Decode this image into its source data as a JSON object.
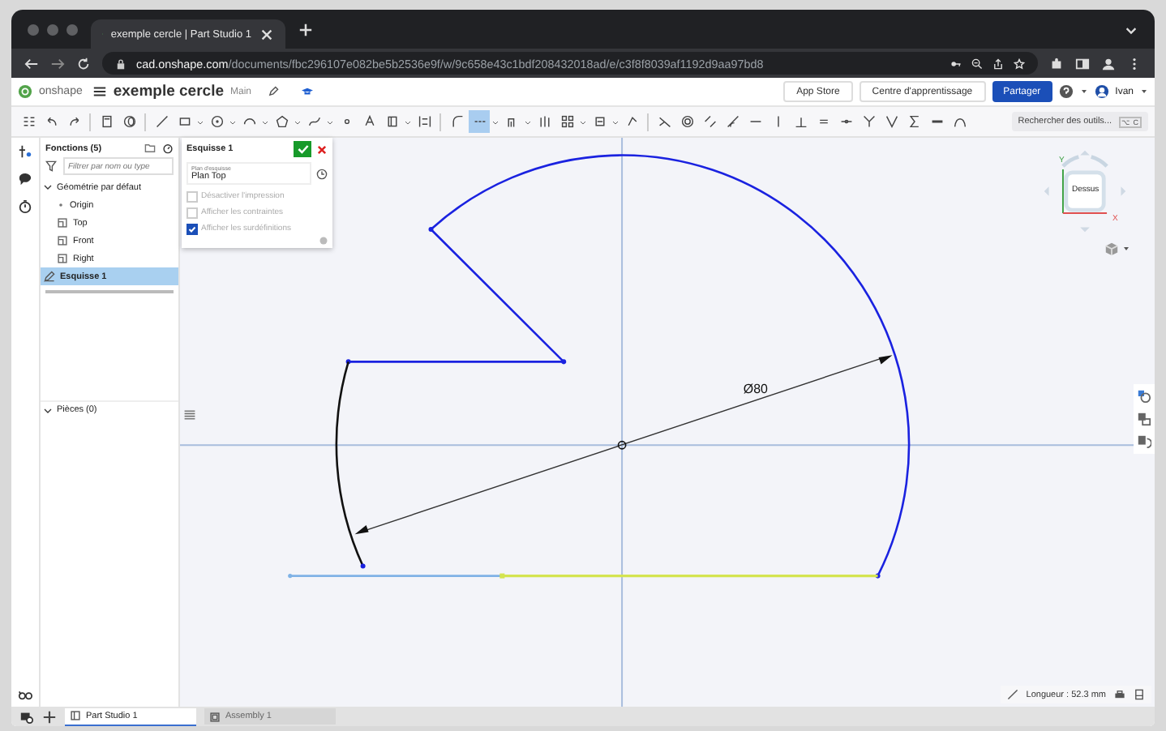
{
  "browser": {
    "tab_title": "exemple cercle | Part Studio 1",
    "url": {
      "host": "cad.onshape.com",
      "path": "/documents/fbc296107e082be5b2536e9f/w/9c658e43c1bdf208432018ad/e/c3f8f8039af1192d9aa97bd8"
    }
  },
  "header": {
    "logo": "onshape",
    "document": "exemple cercle",
    "branch": "Main",
    "buttons": [
      "App Store",
      "Centre d'apprentissage"
    ],
    "share": "Partager",
    "user": "Ivan"
  },
  "toolbar": {
    "tools": [
      {
        "selected": false
      },
      {
        "selected": false
      },
      {
        "selected": false
      },
      {
        "selected": false
      },
      {
        "selected": false
      },
      {
        "selected": false
      },
      {
        "selected": false
      },
      {
        "selected": false
      },
      {
        "selected": false
      },
      {
        "selected": false
      },
      {
        "selected": false
      },
      {
        "selected": false
      },
      {
        "selected": false
      },
      {
        "selected": false
      },
      {
        "selected": false
      },
      {
        "selected": false
      },
      {
        "selected": true
      },
      {
        "selected": false
      },
      {
        "selected": false
      },
      {
        "selected": false
      },
      {
        "selected": false
      },
      {
        "selected": false
      },
      {
        "selected": false
      },
      {
        "selected": false
      },
      {
        "selected": false
      },
      {
        "selected": false
      },
      {
        "selected": false
      },
      {
        "selected": false
      },
      {
        "selected": false
      },
      {
        "selected": false
      },
      {
        "selected": false
      },
      {
        "selected": false
      },
      {
        "selected": false
      },
      {
        "selected": false
      },
      {
        "selected": false
      },
      {
        "selected": false
      }
    ],
    "search": {
      "placeholder": "Rechercher des outils...",
      "shortcut": "⌥ C"
    }
  },
  "feature_panel": {
    "title": "Fonctions (5)",
    "filter": {
      "placeholder": "Filtrer par nom ou type"
    },
    "tree": [
      {
        "label": "Géométrie par défaut",
        "kind": "folder",
        "expanded": true,
        "selected": false,
        "children": [
          {
            "label": "Origin",
            "kind": "point",
            "selected": false
          },
          {
            "label": "Top",
            "kind": "plane",
            "selected": false
          },
          {
            "label": "Front",
            "kind": "plane",
            "selected": false
          },
          {
            "label": "Right",
            "kind": "plane",
            "selected": false
          }
        ]
      },
      {
        "label": "Esquisse 1",
        "kind": "sketch",
        "selected": true
      }
    ],
    "parts": {
      "label": "Pièces (0)",
      "expanded": true
    }
  },
  "sketch_dialog": {
    "title": "Esquisse 1",
    "field": {
      "label": "Plan d'esquisse",
      "value": "Plan Top"
    },
    "options": [
      {
        "label": "Désactiver l'impression",
        "checked": false
      },
      {
        "label": "Afficher les contraintes",
        "checked": false
      },
      {
        "label": "Afficher les surdéfinitions",
        "checked": true
      }
    ]
  },
  "canvas": {
    "dimension": "Ø80",
    "view_cube": {
      "face": "Dessus",
      "axis_y": "Y",
      "axis_x": "X"
    },
    "status": "Longueur : 52.3 mm"
  },
  "bottom_tabs": [
    {
      "label": "Part Studio 1",
      "kind": "studio",
      "selected": true
    },
    {
      "label": "Assembly 1",
      "kind": "assembly",
      "selected": false
    }
  ]
}
